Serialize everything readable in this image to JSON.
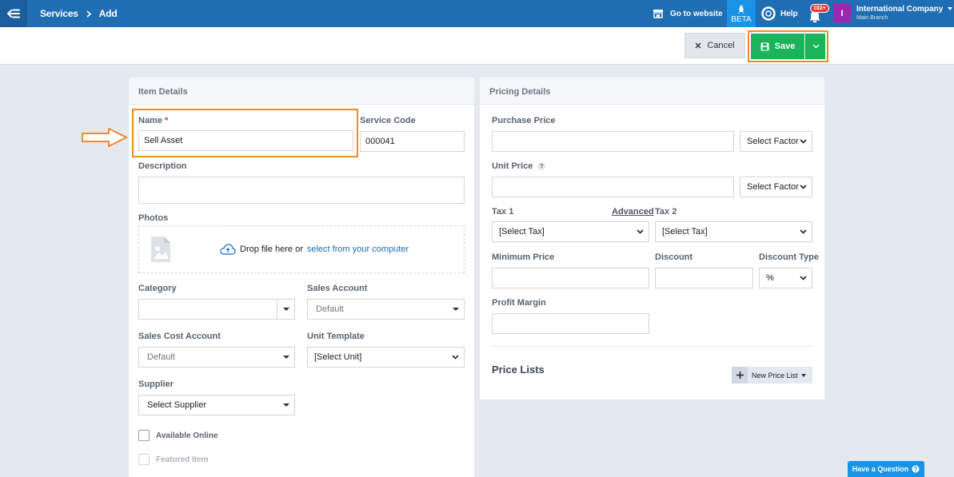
{
  "header": {
    "breadcrumb": [
      "Services",
      "Add"
    ],
    "go_to_website": "Go to website",
    "beta": "BETA",
    "help": "Help",
    "notifications_count": "102+",
    "company_initial": "I",
    "company_name": "International Company",
    "branch": "Main Branch"
  },
  "actions": {
    "cancel": "Cancel",
    "save": "Save"
  },
  "item_details": {
    "title": "Item Details",
    "name_label": "Name",
    "required_mark": "*",
    "name_value": "Sell Asset",
    "service_code_label": "Service Code",
    "service_code_value": "000041",
    "description_label": "Description",
    "description_value": "",
    "photos_label": "Photos",
    "drop_text": "Drop file here or",
    "drop_link": "select from your computer",
    "category_label": "Category",
    "category_value": "",
    "sales_account_label": "Sales Account",
    "sales_account_value": "Default",
    "sales_cost_account_label": "Sales Cost Account",
    "sales_cost_account_value": "Default",
    "unit_template_label": "Unit Template",
    "unit_template_value": "[Select Unit]",
    "supplier_label": "Supplier",
    "supplier_value": "Select Supplier",
    "available_online": "Available Online",
    "featured_item": "Featured Item"
  },
  "pricing": {
    "title": "Pricing Details",
    "purchase_price_label": "Purchase Price",
    "purchase_price_value": "",
    "purchase_factor": "Select Factor",
    "unit_price_label": "Unit Price",
    "unit_price_help": "?",
    "unit_price_value": "",
    "unit_factor": "Select Factor",
    "tax1_label": "Tax 1",
    "advanced_link": "Advanced",
    "tax1_value": "[Select Tax]",
    "tax2_label": "Tax 2",
    "tax2_value": "[Select Tax]",
    "min_price_label": "Minimum Price",
    "discount_label": "Discount",
    "discount_type_label": "Discount Type",
    "discount_type_value": "%",
    "profit_margin_label": "Profit Margin",
    "price_lists_title": "Price Lists",
    "new_price_list": "New Price List"
  },
  "help_button": "Have a Question",
  "colors": {
    "topbar": "#1f6db3",
    "save": "#1bb35b",
    "highlight": "#f08a2c",
    "link": "#1f6db3"
  }
}
